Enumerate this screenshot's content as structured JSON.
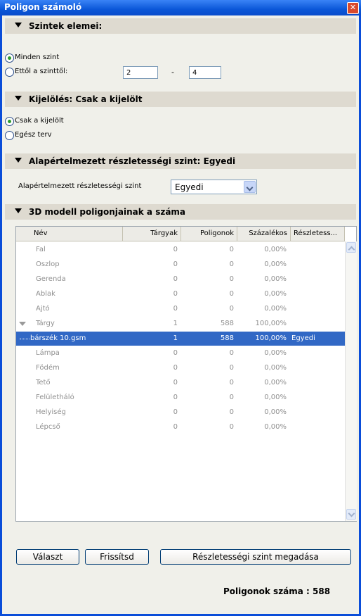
{
  "window": {
    "title": "Poligon számoló"
  },
  "section_levels": {
    "title": "Szintek elemei:",
    "radio_all": "Minden szint",
    "radio_range": "Ettől a szinttől:",
    "from_value": "2",
    "dash": "-",
    "to_value": "4"
  },
  "section_selection": {
    "title": "Kijelölés: Csak a kijelölt",
    "radio_selected": "Csak a kijelölt",
    "radio_whole": "Egész terv"
  },
  "section_detail": {
    "title": "Alapértelmezett részletességi szint: Egyedi",
    "label": "Alapértelmezett részletességi szint",
    "select_value": "Egyedi"
  },
  "section_polygons": {
    "title": "3D modell poligonjainak a száma"
  },
  "table": {
    "headers": [
      "Név",
      "Tárgyak",
      "Poligonok",
      "Százalékos",
      "Részletess..."
    ],
    "rows": [
      {
        "name": "Fal",
        "objects": "0",
        "polygons": "0",
        "percent": "0,00%",
        "detail": ""
      },
      {
        "name": "Oszlop",
        "objects": "0",
        "polygons": "0",
        "percent": "0,00%",
        "detail": ""
      },
      {
        "name": "Gerenda",
        "objects": "0",
        "polygons": "0",
        "percent": "0,00%",
        "detail": ""
      },
      {
        "name": "Ablak",
        "objects": "0",
        "polygons": "0",
        "percent": "0,00%",
        "detail": ""
      },
      {
        "name": "Ajtó",
        "objects": "0",
        "polygons": "0",
        "percent": "0,00%",
        "detail": ""
      },
      {
        "name": "Tárgy",
        "objects": "1",
        "polygons": "588",
        "percent": "100,00%",
        "detail": ""
      },
      {
        "name": "bárszék 10.gsm",
        "objects": "1",
        "polygons": "588",
        "percent": "100,00%",
        "detail": "Egyedi"
      },
      {
        "name": "Lámpa",
        "objects": "0",
        "polygons": "0",
        "percent": "0,00%",
        "detail": ""
      },
      {
        "name": "Födém",
        "objects": "0",
        "polygons": "0",
        "percent": "0,00%",
        "detail": ""
      },
      {
        "name": "Tető",
        "objects": "0",
        "polygons": "0",
        "percent": "0,00%",
        "detail": ""
      },
      {
        "name": "Felületháló",
        "objects": "0",
        "polygons": "0",
        "percent": "0,00%",
        "detail": ""
      },
      {
        "name": "Helyiség",
        "objects": "0",
        "polygons": "0",
        "percent": "0,00%",
        "detail": ""
      },
      {
        "name": "Lépcső",
        "objects": "0",
        "polygons": "0",
        "percent": "0,00%",
        "detail": ""
      }
    ]
  },
  "buttons": {
    "choose": "Választ",
    "refresh": "Frissítsd",
    "set_detail": "Részletességi szint megadása"
  },
  "total": "Poligonok száma : 588",
  "colors": {
    "selection": "#3168c5",
    "titlebar": "#0a4dd9"
  }
}
